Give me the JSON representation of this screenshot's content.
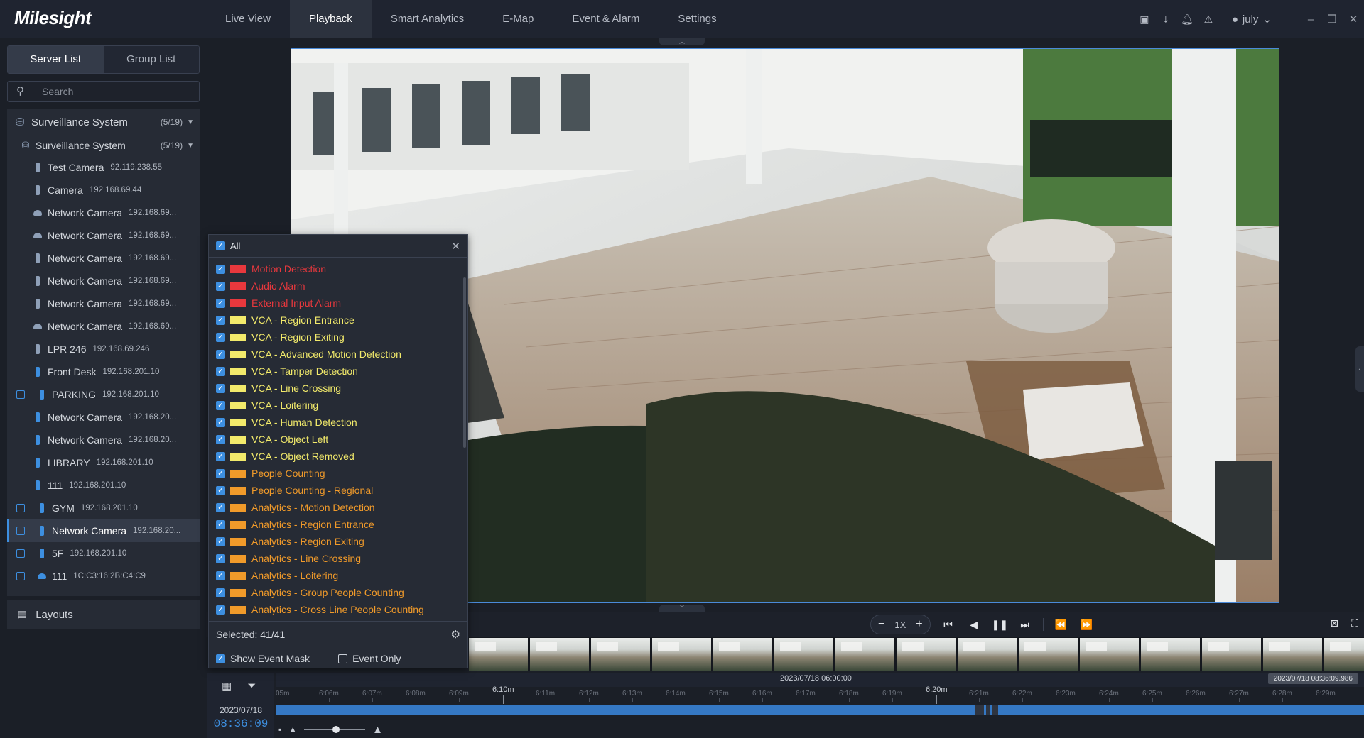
{
  "app": {
    "logo": "Milesight"
  },
  "nav": [
    "Live View",
    "Playback",
    "Smart Analytics",
    "E-Map",
    "Event & Alarm",
    "Settings"
  ],
  "user": {
    "name": "july"
  },
  "sidebar": {
    "tabs": [
      "Server List",
      "Group List"
    ],
    "search_placeholder": "Search",
    "root": {
      "name": "Surveillance System",
      "count": "(5/19)"
    },
    "sub": {
      "name": "Surveillance System",
      "count": "(5/19)"
    },
    "items": [
      {
        "name": "Test Camera",
        "ip": "92.119.238.55"
      },
      {
        "name": "Camera",
        "ip": "192.168.69.44"
      },
      {
        "name": "Network Camera",
        "ip": "192.168.69..."
      },
      {
        "name": "Network Camera",
        "ip": "192.168.69..."
      },
      {
        "name": "Network Camera",
        "ip": "192.168.69..."
      },
      {
        "name": "Network Camera",
        "ip": "192.168.69..."
      },
      {
        "name": "Network Camera",
        "ip": "192.168.69..."
      },
      {
        "name": "Network Camera",
        "ip": "192.168.69..."
      },
      {
        "name": "LPR 246",
        "ip": "192.168.69.246"
      },
      {
        "name": "Front Desk",
        "ip": "192.168.201.10"
      },
      {
        "name": "PARKING",
        "ip": "192.168.201.10"
      },
      {
        "name": "Network Camera",
        "ip": "192.168.20..."
      },
      {
        "name": "Network Camera",
        "ip": "192.168.20..."
      },
      {
        "name": "LIBRARY",
        "ip": "192.168.201.10"
      },
      {
        "name": "111",
        "ip": "192.168.201.10"
      },
      {
        "name": "GYM",
        "ip": "192.168.201.10"
      },
      {
        "name": "Network Camera",
        "ip": "192.168.20..."
      },
      {
        "name": "5F",
        "ip": "192.168.201.10"
      },
      {
        "name": "111",
        "ip": "1C:C3:16:2B:C4:C9"
      }
    ],
    "layouts": "Layouts"
  },
  "event_panel": {
    "all_label": "All",
    "items": [
      {
        "label": "Motion Detection",
        "color": "#e8383d"
      },
      {
        "label": "Audio Alarm",
        "color": "#e8383d"
      },
      {
        "label": "External Input Alarm",
        "color": "#e8383d"
      },
      {
        "label": "VCA - Region Entrance",
        "color": "#f2ea6b"
      },
      {
        "label": "VCA - Region Exiting",
        "color": "#f2ea6b"
      },
      {
        "label": "VCA - Advanced Motion Detection",
        "color": "#f2ea6b"
      },
      {
        "label": "VCA - Tamper Detection",
        "color": "#f2ea6b"
      },
      {
        "label": "VCA - Line Crossing",
        "color": "#f2ea6b"
      },
      {
        "label": "VCA - Loitering",
        "color": "#f2ea6b"
      },
      {
        "label": "VCA - Human Detection",
        "color": "#f2ea6b"
      },
      {
        "label": "VCA - Object Left",
        "color": "#f2ea6b"
      },
      {
        "label": "VCA - Object Removed",
        "color": "#f2ea6b"
      },
      {
        "label": "People Counting",
        "color": "#f09a2a"
      },
      {
        "label": "People Counting - Regional",
        "color": "#f09a2a"
      },
      {
        "label": "Analytics - Motion Detection",
        "color": "#f09a2a"
      },
      {
        "label": "Analytics - Region Entrance",
        "color": "#f09a2a"
      },
      {
        "label": "Analytics - Region Exiting",
        "color": "#f09a2a"
      },
      {
        "label": "Analytics - Line Crossing",
        "color": "#f09a2a"
      },
      {
        "label": "Analytics - Loitering",
        "color": "#f09a2a"
      },
      {
        "label": "Analytics - Group People Counting",
        "color": "#f09a2a"
      },
      {
        "label": "Analytics - Cross Line People Counting",
        "color": "#f09a2a"
      }
    ],
    "selected": "Selected: 41/41",
    "show_event_mask": "Show Event Mask",
    "event_only": "Event Only"
  },
  "playback": {
    "speed": "1X"
  },
  "timeline": {
    "date": "2023/07/18",
    "time": "08:36:09",
    "center_label": "2023/07/18 06:00:00",
    "cursor_label": "2023/07/18 08:36:09.986",
    "ticks": [
      "05m",
      "6:06m",
      "6:07m",
      "6:08m",
      "6:09m",
      "6:10m",
      "6:11m",
      "6:12m",
      "6:13m",
      "6:14m",
      "6:15m",
      "6:16m",
      "6:17m",
      "6:18m",
      "6:19m",
      "6:20m",
      "6:21m",
      "6:22m",
      "6:23m",
      "6:24m",
      "6:25m",
      "6:26m",
      "6:27m",
      "6:28m",
      "6:29m"
    ]
  }
}
